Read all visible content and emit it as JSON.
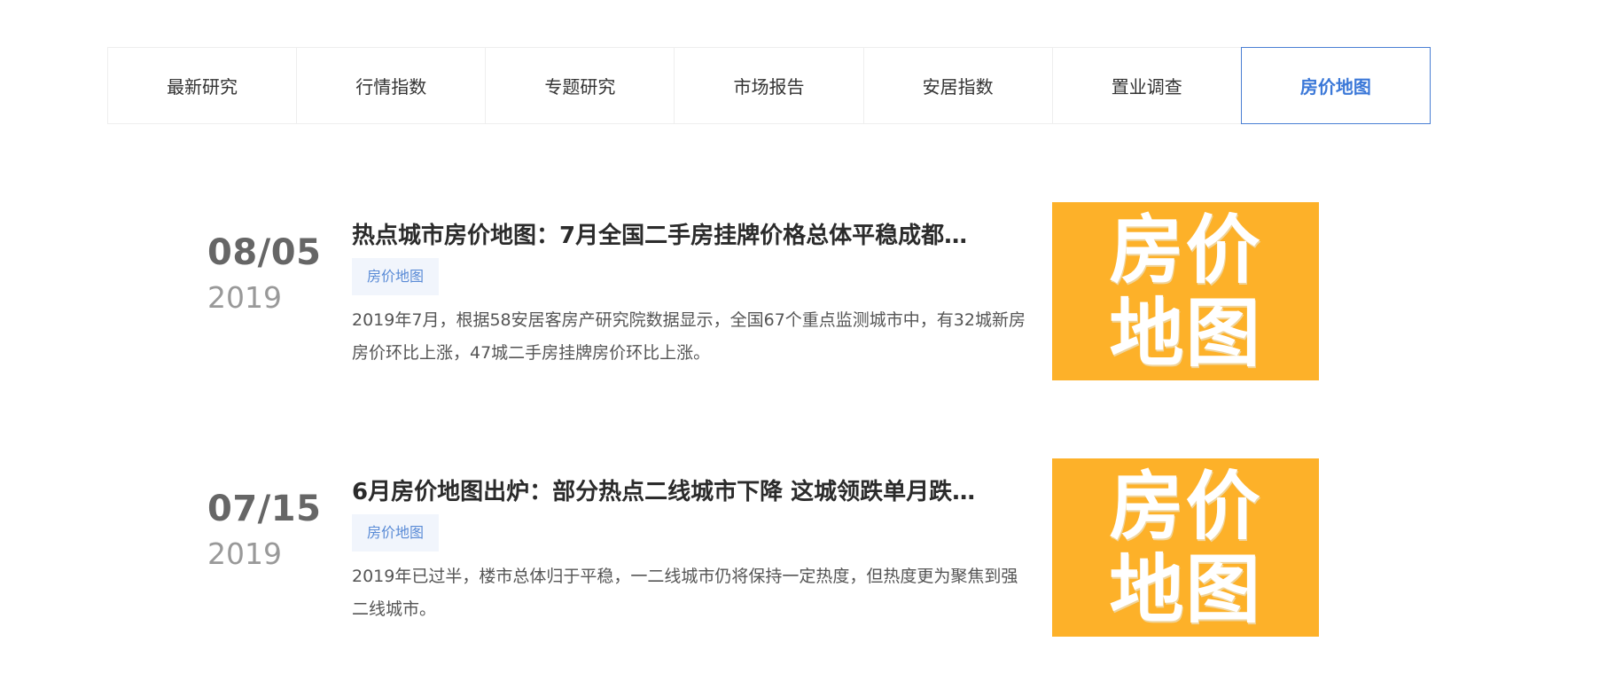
{
  "tabs": [
    {
      "label": "最新研究"
    },
    {
      "label": "行情指数"
    },
    {
      "label": "专题研究"
    },
    {
      "label": "市场报告"
    },
    {
      "label": "安居指数"
    },
    {
      "label": "置业调查"
    },
    {
      "label": "房价地图"
    }
  ],
  "active_tab": "房价地图",
  "articles": [
    {
      "date_md": "08/05",
      "year": "2019",
      "title": "热点城市房价地图：7月全国二手房挂牌价格总体平稳成都…",
      "tag": "房价地图",
      "desc": "2019年7月，根据58安居客房产研究院数据显示，全国67个重点监测城市中，有32城新房房价环比上涨，47城二手房挂牌房价环比上涨。",
      "thumb_line1": "房价",
      "thumb_line2": "地图"
    },
    {
      "date_md": "07/15",
      "year": "2019",
      "title": "6月房价地图出炉：部分热点二线城市下降 这城领跌单月跌…",
      "tag": "房价地图",
      "desc": "2019年已过半，楼市总体归于平稳，一二线城市仍将保持一定热度，但热度更为聚焦到强二线城市。",
      "thumb_line1": "房价",
      "thumb_line2": "地图"
    }
  ],
  "colors": {
    "accent": "#3b78d8",
    "thumb_bg": "#fdb129",
    "tag_bg": "#f1f5fc"
  }
}
